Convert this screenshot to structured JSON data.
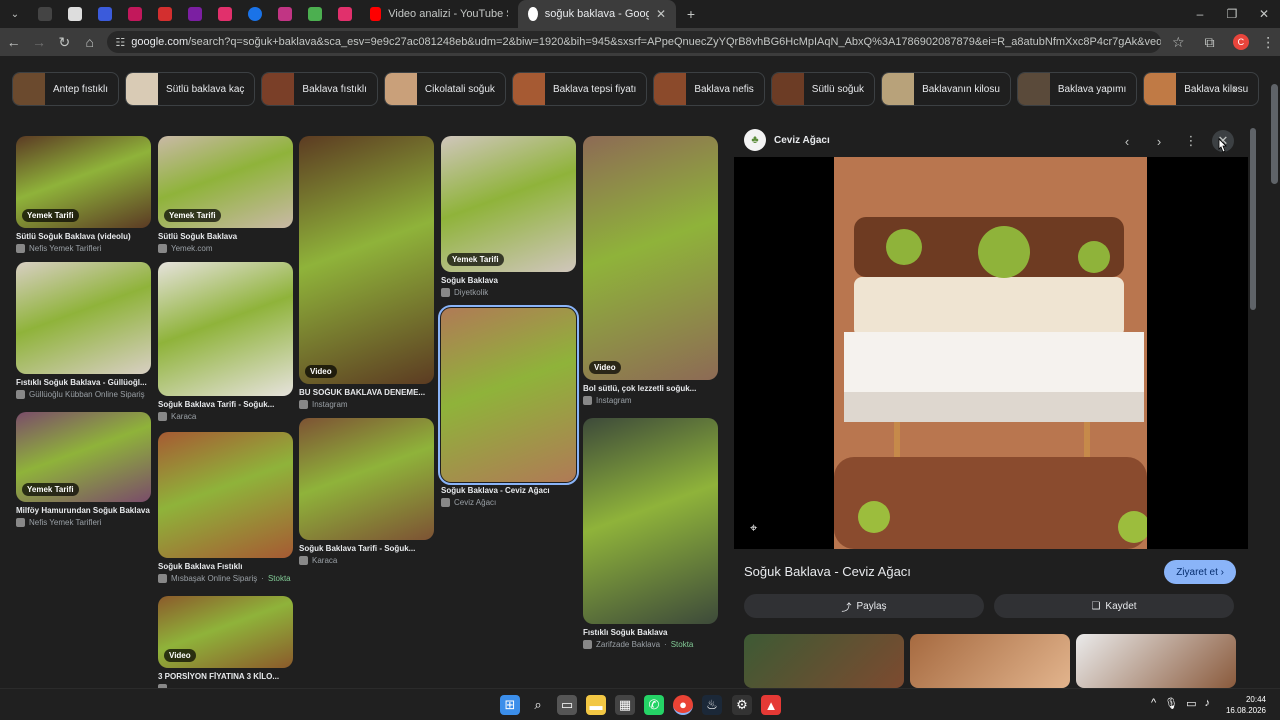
{
  "browser": {
    "tabs": [
      {
        "title": "Video analizi - YouTube Studio",
        "icon": "youtube-icon"
      },
      {
        "title": "soğuk baklava - Google'da Ara",
        "icon": "google-icon",
        "active": true
      }
    ],
    "url_host": "google.com",
    "url_rest": "/search?q=soğuk+baklava&sca_esv=9e9c27ac081248eb&udm=2&biw=1920&bih=945&sxsrf=APpeQnuecZyYQrB8vhBG6HcMpIAqN_AbxQ%3A1786902087879&ei=R_a8atubNfmXxc8P4cr7gAk&ved=0ahUKEwib28iB2aWWAxX5S_EDHW...",
    "profile_letter": "C"
  },
  "chips": [
    "Antep fıstıklı",
    "Sütlü baklava kaç",
    "Baklava fıstıklı",
    "Cikolatali soğuk",
    "Baklava tepsi fiyatı",
    "Baklava nefis",
    "Sütlü soğuk",
    "Baklavanın kilosu",
    "Baklava yapımı",
    "Baklava kilosu"
  ],
  "results": [
    {
      "title": "Sütlü Soğuk Baklava (videolu)",
      "source": "Nefis Yemek Tarifleri",
      "badge": "Yemek Tarifi"
    },
    {
      "title": "Fıstıklı Soğuk Baklava - Güllüoğl...",
      "source": "Güllüoğlu Kübban Online Sipariş",
      "badge": ""
    },
    {
      "title": "Milföy Hamurundan Soğuk Baklava",
      "source": "Nefis Yemek Tarifleri",
      "badge": "Yemek Tarifi"
    },
    {
      "title": "Sütlü Soğuk Baklava",
      "source": "Yemek.com",
      "badge": "Yemek Tarifi"
    },
    {
      "title": "Soğuk Baklava Tarifi - Soğuk...",
      "source": "Karaca",
      "badge": ""
    },
    {
      "title": "Soğuk Baklava Fıstıklı",
      "source": "Mısbaşak Online Sipariş",
      "stock": "Stokta",
      "badge": ""
    },
    {
      "title": "3 PORSİYON FİYATINA 3 KİLO...",
      "source": "",
      "badge": "Video"
    },
    {
      "title": "BU SOĞUK BAKLAVA DENEME...",
      "source": "Instagram",
      "badge": "Video"
    },
    {
      "title": "Soğuk Baklava Tarifi - Soğuk...",
      "source": "Karaca",
      "badge": ""
    },
    {
      "title": "Soğuk Baklava",
      "source": "Diyetkolik",
      "badge": "Yemek Tarifi"
    },
    {
      "title": "Soğuk Baklava - Ceviz Ağacı",
      "source": "Ceviz Ağacı",
      "badge": ""
    },
    {
      "title": "Bol sütlü, çok lezzetli soğuk...",
      "source": "Instagram",
      "badge": "Video"
    },
    {
      "title": "Fıstıklı Soğuk Baklava",
      "source": "Zarifzade Baklava",
      "stock": "Stokta",
      "badge": ""
    }
  ],
  "panel": {
    "source": "Ceviz Ağacı",
    "title": "Soğuk Baklava - Ceviz Ağacı",
    "visit": "Ziyaret et",
    "share": "Paylaş",
    "save": "Kaydet"
  },
  "taskbar": {
    "time": "20:44",
    "date": "16.08.2026"
  }
}
